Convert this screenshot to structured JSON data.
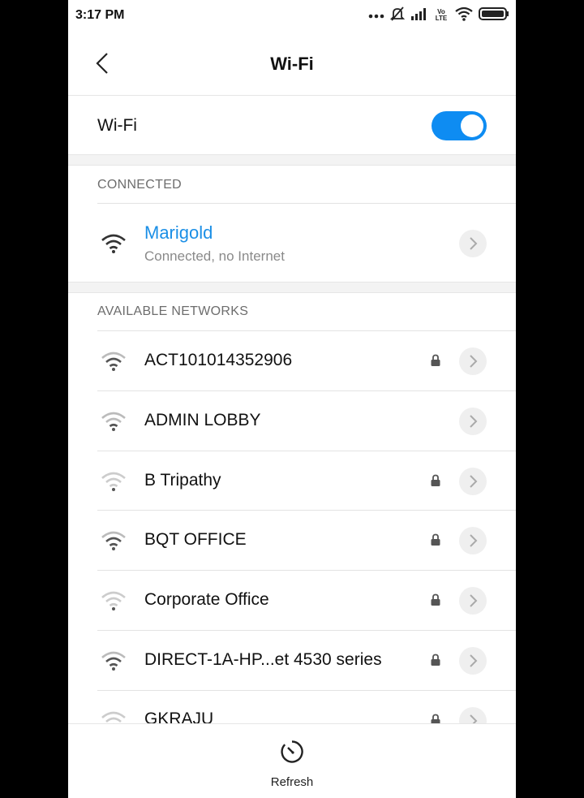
{
  "status_bar": {
    "time": "3:17 PM",
    "lte_label": "Vo LTE"
  },
  "header": {
    "title": "Wi-Fi"
  },
  "wifi_toggle": {
    "label": "Wi-Fi",
    "enabled": true,
    "accent": "#0e8cf2"
  },
  "connected": {
    "section_label": "CONNECTED",
    "network": {
      "name": "Marigold",
      "status": "Connected, no Internet",
      "name_color": "#1b8fe6"
    }
  },
  "available": {
    "section_label": "AVAILABLE NETWORKS",
    "networks": [
      {
        "name": "ACT101014352906",
        "locked": true
      },
      {
        "name": "ADMIN LOBBY",
        "locked": false
      },
      {
        "name": "B Tripathy",
        "locked": true
      },
      {
        "name": "BQT OFFICE",
        "locked": true
      },
      {
        "name": "Corporate Office",
        "locked": true
      },
      {
        "name": "DIRECT-1A-HP...et 4530 series",
        "locked": true
      },
      {
        "name": "GKRAJU",
        "locked": true
      }
    ]
  },
  "bottom_bar": {
    "refresh_label": "Refresh"
  }
}
